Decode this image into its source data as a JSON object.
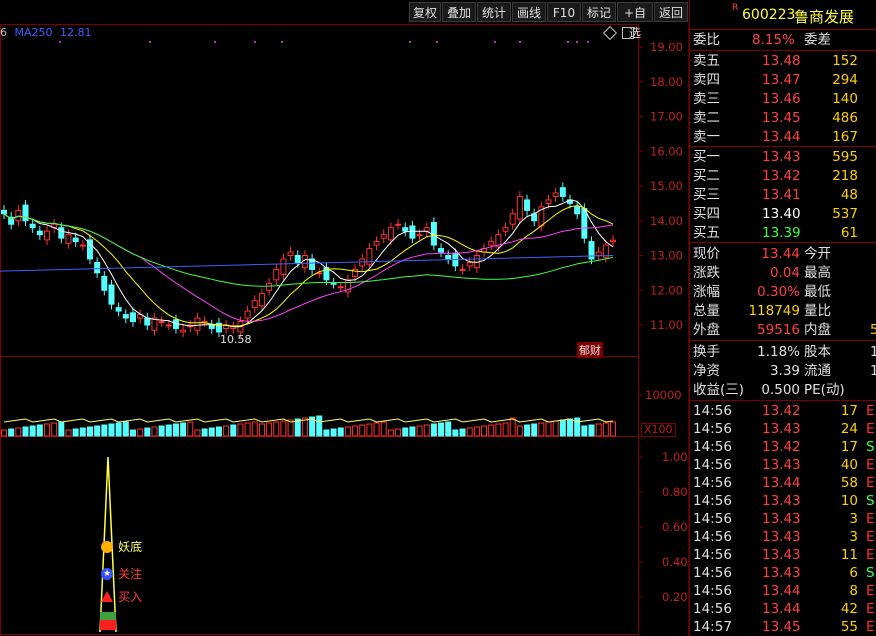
{
  "toolbar": {
    "buttons": [
      "复权",
      "叠加",
      "统计",
      "画线",
      "F10",
      "标记",
      "+自选",
      "返回"
    ]
  },
  "main_chart": {
    "ma_label": "MA250",
    "ma_value": "12.81",
    "left_digit": "6",
    "low_label": "10.58",
    "finance_badge": "郁财",
    "y_ticks": [
      "19.00",
      "18.00",
      "17.00",
      "16.00",
      "15.00",
      "14.00",
      "13.00",
      "12.00",
      "11.00"
    ]
  },
  "volume_chart": {
    "y_ticks": [
      "10000"
    ],
    "unit": "X100"
  },
  "indicator_chart": {
    "y_ticks": [
      "1.00",
      "0.80",
      "0.60",
      "0.40",
      "0.20"
    ],
    "signals": [
      "妖底",
      "关注",
      "买入"
    ]
  },
  "quote": {
    "code": "600223",
    "name": "鲁商发展",
    "r_mark": "R",
    "wei_bi_label": "委比",
    "wei_bi": "8.15%",
    "wei_cha_label": "委差",
    "asks": [
      {
        "label": "卖五",
        "price": "13.48",
        "vol": "152"
      },
      {
        "label": "卖四",
        "price": "13.47",
        "vol": "294"
      },
      {
        "label": "卖三",
        "price": "13.46",
        "vol": "140"
      },
      {
        "label": "卖二",
        "price": "13.45",
        "vol": "486"
      },
      {
        "label": "卖一",
        "price": "13.44",
        "vol": "167"
      }
    ],
    "bids": [
      {
        "label": "买一",
        "price": "13.43",
        "vol": "595"
      },
      {
        "label": "买二",
        "price": "13.42",
        "vol": "218"
      },
      {
        "label": "买三",
        "price": "13.41",
        "vol": "48"
      },
      {
        "label": "买四",
        "price": "13.40",
        "vol": "537"
      },
      {
        "label": "买五",
        "price": "13.39",
        "vol": "61"
      }
    ],
    "stats": [
      {
        "l1": "现价",
        "v1": "13.44",
        "l2": "今开"
      },
      {
        "l1": "涨跌",
        "v1": "0.04",
        "l2": "最高"
      },
      {
        "l1": "涨幅",
        "v1": "0.30%",
        "l2": "最低"
      },
      {
        "l1": "总量",
        "v1": "118749",
        "l2": "量比"
      },
      {
        "l1": "外盘",
        "v1": "59516",
        "l2": "内盘",
        "v2": "5"
      }
    ],
    "stats2": [
      {
        "l1": "换手",
        "v1": "1.18%",
        "l2": "股本",
        "v2": "1"
      },
      {
        "l1": "净资",
        "v1": "3.39",
        "l2": "流通",
        "v2": "1"
      },
      {
        "l1": "收益(三)",
        "v1": "0.500",
        "l2": "PE(动)"
      }
    ],
    "ticks": [
      {
        "time": "14:56",
        "price": "13.42",
        "vol": "17",
        "flag": "E"
      },
      {
        "time": "14:56",
        "price": "13.43",
        "vol": "24",
        "flag": "E"
      },
      {
        "time": "14:56",
        "price": "13.42",
        "vol": "17",
        "flag": "S"
      },
      {
        "time": "14:56",
        "price": "13.43",
        "vol": "40",
        "flag": "E"
      },
      {
        "time": "14:56",
        "price": "13.44",
        "vol": "58",
        "flag": "E"
      },
      {
        "time": "14:56",
        "price": "13.43",
        "vol": "10",
        "flag": "S"
      },
      {
        "time": "14:56",
        "price": "13.43",
        "vol": "3",
        "flag": "E"
      },
      {
        "time": "14:56",
        "price": "13.43",
        "vol": "3",
        "flag": "E"
      },
      {
        "time": "14:56",
        "price": "13.43",
        "vol": "11",
        "flag": "E"
      },
      {
        "time": "14:56",
        "price": "13.43",
        "vol": "6",
        "flag": "S"
      },
      {
        "time": "14:56",
        "price": "13.44",
        "vol": "8",
        "flag": "E"
      },
      {
        "time": "14:56",
        "price": "13.44",
        "vol": "42",
        "flag": "E"
      },
      {
        "time": "14:57",
        "price": "13.45",
        "vol": "55",
        "flag": "E"
      }
    ]
  },
  "colors": {
    "up": "#ff3030",
    "down": "#54ffff",
    "border": "#800000"
  }
}
